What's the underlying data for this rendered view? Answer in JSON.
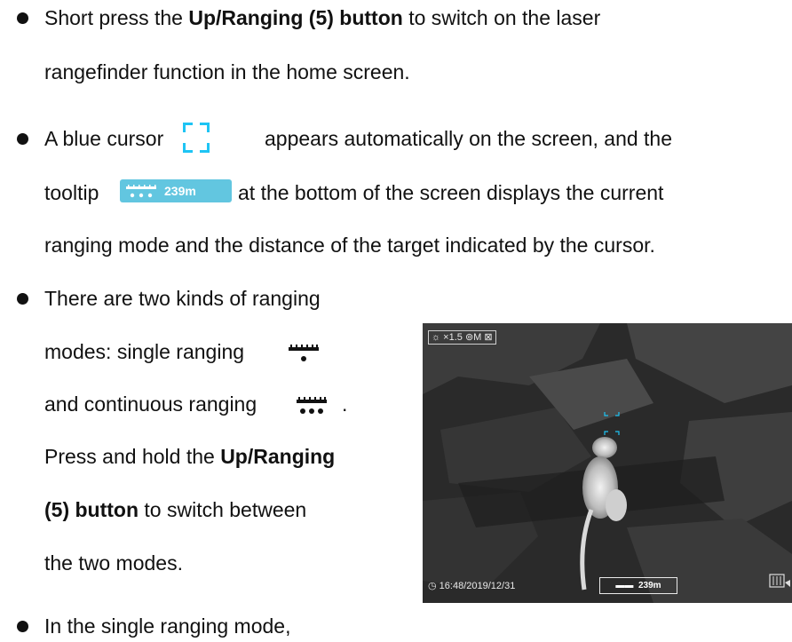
{
  "bullets": [
    {
      "before": "Short press the ",
      "bold": "Up/Ranging (5) button",
      "after": " to switch on the laser",
      "line2": "rangefinder function in the home screen."
    },
    {
      "line1_before": "A blue cursor ",
      "line1_after": " appears automatically on the screen, and the",
      "line2_before": "tooltip ",
      "line2_after": " at the bottom of the screen displays the current",
      "line3": "ranging mode and the distance of the target indicated by the cursor."
    },
    {
      "line1": "There are two kinds of ranging",
      "line2": "modes: single ranging",
      "line3": "and continuous ranging",
      "line3_end": ".",
      "line4_before": "Press and hold the ",
      "line4_bold": "Up/Ranging",
      "line5_bold": "(5) button",
      "line5_after": " to switch between",
      "line6": "the two modes."
    },
    {
      "line1": "In the single ranging mode,"
    }
  ],
  "tooltip": {
    "distance": "239m",
    "color": "#62c6e0"
  },
  "cursor": {
    "color": "#1ec4f4",
    "icon": "corner-brackets-icon"
  },
  "thermal": {
    "hud_top": "×1.5",
    "hud_mode": "M",
    "timestamp": "16:48/2019/12/31",
    "distance": "239m"
  }
}
